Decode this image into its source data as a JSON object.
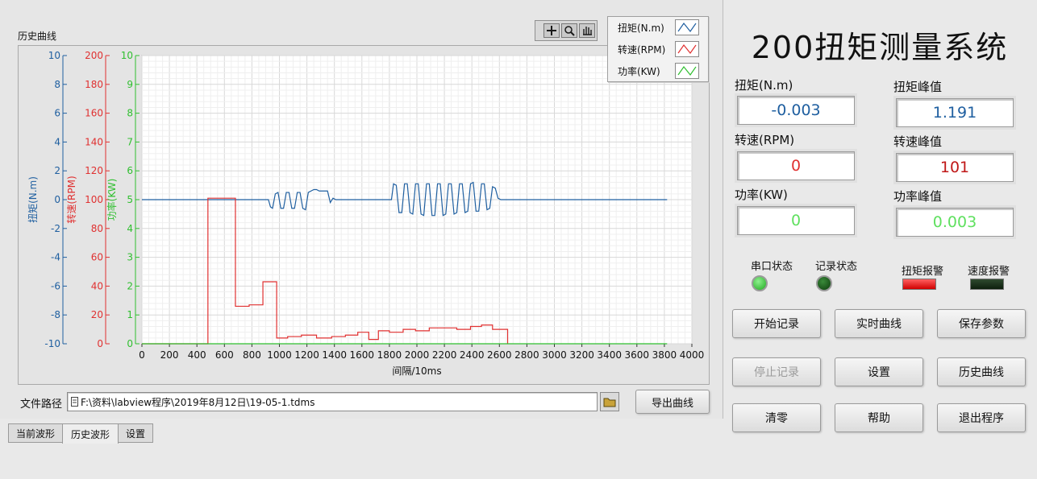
{
  "left": {
    "graph_title": "历史曲线",
    "legend": [
      {
        "label": "扭矩(N.m)",
        "color": "#1f5fa0"
      },
      {
        "label": "转速(RPM)",
        "color": "#e03030"
      },
      {
        "label": "功率(KW)",
        "color": "#2fbf2f"
      }
    ],
    "file_path_label": "文件路径",
    "file_path_value": "F:\\资料\\labview程序\\2019年8月12日\\19-05-1.tdms",
    "export_button": "导出曲线",
    "tabs": [
      "当前波形",
      "历史波形",
      "设置"
    ],
    "active_tab": 1
  },
  "chart_data": {
    "type": "line",
    "xlabel": "间隔/10ms",
    "xlim": [
      0,
      4000
    ],
    "x_ticks": [
      "0",
      "200",
      "400",
      "600",
      "800",
      "1000",
      "1200",
      "1400",
      "1600",
      "1800",
      "2000",
      "2200",
      "2400",
      "2600",
      "2800",
      "3000",
      "3200",
      "3400",
      "3600",
      "3800",
      "4000"
    ],
    "y_axes": [
      {
        "label": "扭矩(N.m)",
        "color": "#1f5fa0",
        "range": [
          -10,
          10
        ],
        "ticks": [
          "10",
          "8",
          "6",
          "4",
          "2",
          "0",
          "-2",
          "-4",
          "-6",
          "-8",
          "-10"
        ]
      },
      {
        "label": "转速(RPM)",
        "color": "#e03030",
        "range": [
          0,
          200
        ],
        "ticks": [
          "200",
          "180",
          "160",
          "140",
          "120",
          "100",
          "80",
          "60",
          "40",
          "20",
          "0"
        ]
      },
      {
        "label": "功率(KW)",
        "color": "#2fbf2f",
        "range": [
          0,
          10
        ],
        "ticks": [
          "10",
          "9",
          "8",
          "7",
          "6",
          "5",
          "4",
          "3",
          "2",
          "1",
          "0"
        ]
      }
    ],
    "grid": true,
    "series": [
      {
        "name": "扭矩(N.m)",
        "color": "#1f5fa0",
        "axis": 0,
        "x": [
          0,
          920,
          935,
          950,
          970,
          990,
          1010,
          1030,
          1050,
          1070,
          1090,
          1110,
          1130,
          1150,
          1170,
          1190,
          1210,
          1230,
          1250,
          1270,
          1290,
          1310,
          1330,
          1350,
          1370,
          1390,
          1410,
          1430,
          1450,
          1800,
          1815,
          1830,
          1850,
          1870,
          1890,
          1910,
          1930,
          1950,
          1970,
          1990,
          2010,
          2030,
          2050,
          2070,
          2090,
          2110,
          2130,
          2150,
          2170,
          2190,
          2210,
          2230,
          2250,
          2270,
          2290,
          2310,
          2330,
          2350,
          2370,
          2390,
          2410,
          2430,
          2450,
          2470,
          2490,
          2510,
          2530,
          2550,
          2570,
          2590,
          2610,
          2630,
          3820
        ],
        "y": [
          0,
          0,
          -0.5,
          -0.6,
          0.4,
          0.5,
          -0.6,
          -0.6,
          0.5,
          0.5,
          -0.6,
          -0.6,
          0.5,
          0.5,
          -0.6,
          -0.7,
          0.5,
          0.6,
          0.7,
          0.7,
          0.6,
          0.6,
          0.6,
          0.6,
          -0.2,
          0.1,
          0,
          0,
          0,
          0,
          0,
          1.1,
          1.0,
          -0.9,
          -0.9,
          1.1,
          1.1,
          -0.9,
          -1.0,
          1.1,
          1.1,
          -1.0,
          -1.1,
          1.1,
          1.1,
          -1.1,
          -1.1,
          1.1,
          1.1,
          -1.1,
          -1.0,
          1.1,
          1.1,
          -1.0,
          -0.9,
          1.1,
          1.1,
          -0.9,
          -0.8,
          1.1,
          1.2,
          -0.8,
          -0.8,
          1.1,
          1.1,
          -0.7,
          -0.6,
          0.9,
          0.8,
          0.1,
          0,
          0,
          0
        ]
      },
      {
        "name": "转速(RPM)",
        "color": "#e03030",
        "axis": 1,
        "step": true,
        "x": [
          0,
          480,
          680,
          780,
          880,
          980,
          1060,
          1160,
          1270,
          1380,
          1480,
          1570,
          1650,
          1720,
          1800,
          1900,
          1990,
          2090,
          2200,
          2290,
          2390,
          2470,
          2550,
          2660
        ],
        "y": [
          0,
          101,
          26,
          27,
          43,
          4,
          5,
          6,
          4,
          5,
          6,
          8,
          3,
          9,
          8,
          10,
          9,
          11,
          11,
          10,
          12,
          13,
          10,
          0
        ]
      },
      {
        "name": "功率(KW)",
        "color": "#2fbf2f",
        "axis": 2,
        "x": [
          0,
          3820
        ],
        "y": [
          0,
          0
        ]
      }
    ]
  },
  "right": {
    "title": "200扭矩测量系统",
    "torque_label": "扭矩(N.m)",
    "torque_value": "-0.003",
    "speed_label": "转速(RPM)",
    "speed_value": "0",
    "power_label": "功率(KW)",
    "power_value": "0",
    "torque_peak_label": "扭矩峰值",
    "torque_peak_value": "1.191",
    "speed_peak_label": "转速峰值",
    "speed_peak_value": "101",
    "power_peak_label": "功率峰值",
    "power_peak_value": "0.003",
    "serial_status_label": "串口状态",
    "record_status_label": "记录状态",
    "torque_alarm_label": "扭矩报警",
    "speed_alarm_label": "速度报警",
    "buttons": {
      "start_record": "开始记录",
      "realtime_curve": "实时曲线",
      "save_params": "保存参数",
      "stop_record": "停止记录",
      "settings": "设置",
      "history_curve": "历史曲线",
      "zero": "清零",
      "help": "帮助",
      "exit": "退出程序"
    }
  }
}
